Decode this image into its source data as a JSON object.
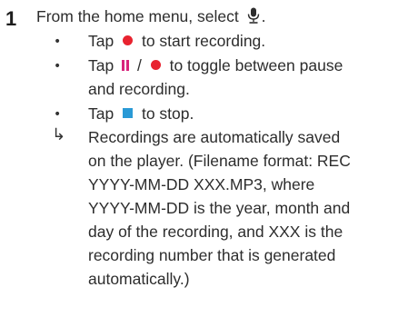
{
  "step": {
    "number": "1",
    "intro_text": "From the home menu, select",
    "intro_end": "."
  },
  "bullets": [
    {
      "before": "Tap",
      "after": "to start recording."
    },
    {
      "before": "Tap",
      "middle": "/",
      "after": "to toggle between pause",
      "line2": "and recording."
    },
    {
      "before": "Tap",
      "after": "to stop."
    }
  ],
  "result": {
    "lines": [
      "Recordings are automatically saved",
      "on the player. (Filename format: REC",
      "YYYY-MM-DD XXX.MP3, where",
      "YYYY-MM-DD is the year, month and",
      "day of the recording, and XXX is the",
      "recording number that is generated",
      "automatically.)"
    ]
  },
  "icons": {
    "record": "record-icon",
    "pause": "pause-icon",
    "stop": "stop-icon",
    "microphone": "microphone-icon",
    "result_arrow": "result-arrow-icon"
  },
  "colors": {
    "record": "#e8232f",
    "pause": "#d8247c",
    "stop": "#2a9ad6",
    "text": "#2d2d2d"
  }
}
